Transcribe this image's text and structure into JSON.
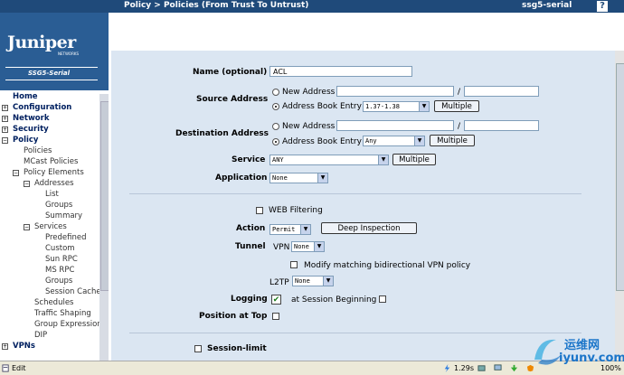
{
  "header": {
    "breadcrumb": "Policy > Policies (From Trust To Untrust)",
    "device": "ssg5-serial",
    "help_label": "?"
  },
  "brand": {
    "logo_text": "Juniper",
    "logo_sub": "NETWORKS",
    "model": "SSG5-Serial"
  },
  "nav": {
    "home": "Home",
    "configuration": "Configuration",
    "network": "Network",
    "security": "Security",
    "policy": "Policy",
    "policies": "Policies",
    "mcast": "MCast Policies",
    "policy_elements": "Policy Elements",
    "addresses": "Addresses",
    "list": "List",
    "groups": "Groups",
    "summary": "Summary",
    "services": "Services",
    "predefined": "Predefined",
    "custom": "Custom",
    "sunrpc": "Sun RPC",
    "msrpc": "MS RPC",
    "svc_groups": "Groups",
    "session_cache": "Session Cache",
    "schedules": "Schedules",
    "traffic_shaping": "Traffic Shaping",
    "group_expression": "Group Expression",
    "dip": "DIP",
    "vpns": "VPNs"
  },
  "form": {
    "name_label": "Name (optional)",
    "name_value": "ACL",
    "source_label": "Source Address",
    "dest_label": "Destination Address",
    "new_address": "New Address",
    "address_book_entry": "Address Book Entry",
    "slash": "/",
    "source_book_value": "1.37-1.38",
    "dest_book_value": "Any",
    "multiple": "Multiple",
    "service_label": "Service",
    "service_value": "ANY",
    "application_label": "Application",
    "application_value": "None",
    "web_filtering": "WEB Filtering",
    "action_label": "Action",
    "action_value": "Permit",
    "deep_inspection": "Deep Inspection",
    "tunnel_label": "Tunnel",
    "vpn_label": "VPN",
    "vpn_value": "None",
    "modify_bidir": "Modify matching bidirectional VPN policy",
    "l2tp_label": "L2TP",
    "l2tp_value": "None",
    "logging_label": "Logging",
    "at_session_beginning": "at Session Beginning",
    "position_top_label": "Position at Top",
    "session_limit": "Session-limit"
  },
  "status": {
    "edit": "Edit",
    "time": "1.29s",
    "zoom": "100%"
  },
  "watermark": {
    "cn": "运维网",
    "url": "iyunv.com"
  },
  "colors": {
    "header_bg": "#1f4a7a",
    "logo_bg": "#2a5d94",
    "panel_bg": "#dbe6f2"
  }
}
